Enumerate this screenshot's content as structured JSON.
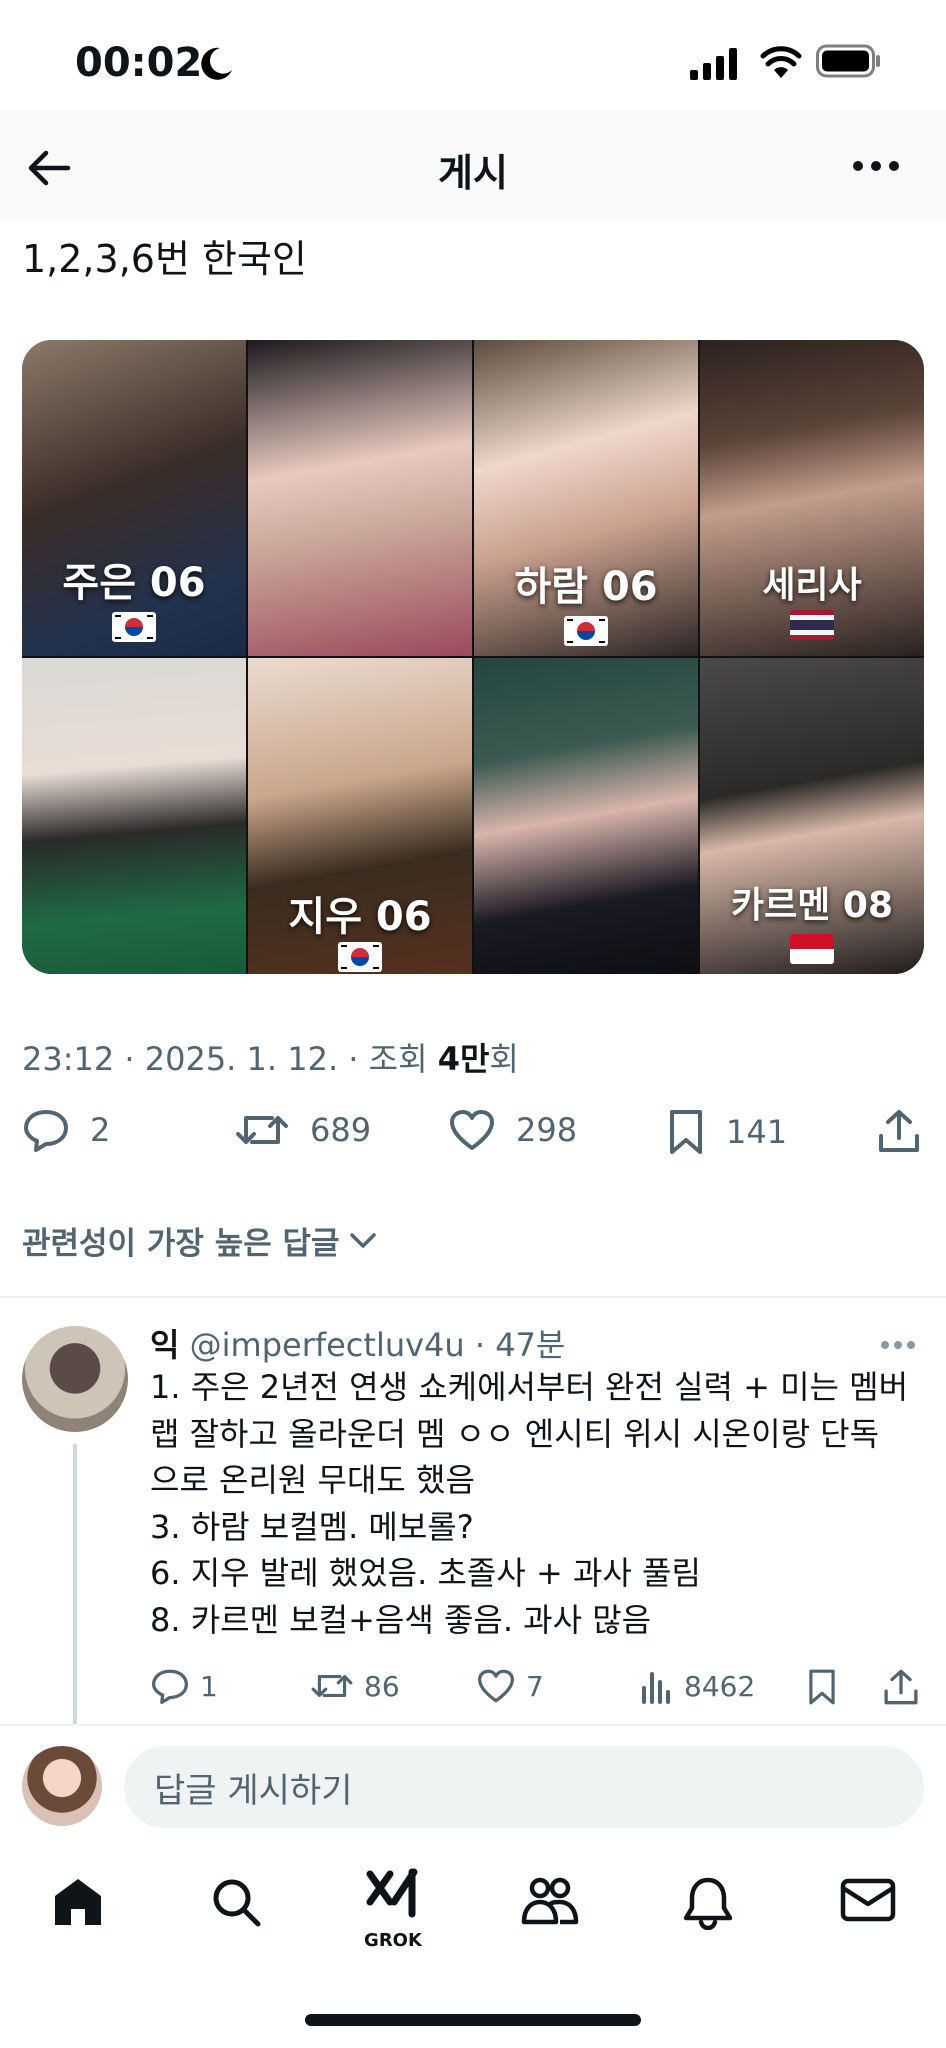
{
  "status_bar": {
    "time": "00:02"
  },
  "header": {
    "title": "게시"
  },
  "tweet": {
    "text": "1,2,3,6번 한국인",
    "images": [
      {
        "caption": "주은 06",
        "flag": "kr"
      },
      {
        "caption": "",
        "flag": ""
      },
      {
        "caption": "하람 06",
        "flag": "kr"
      },
      {
        "caption": "세리사",
        "flag": "th"
      },
      {
        "caption": "",
        "flag": ""
      },
      {
        "caption": "지우 06",
        "flag": "kr"
      },
      {
        "caption": "",
        "flag": ""
      },
      {
        "caption": "카르멘 08",
        "flag": "id"
      }
    ],
    "meta_prefix": "23:12 · 2025. 1. 12. · 조회 ",
    "views": "4만",
    "views_suffix": "회",
    "replies": "2",
    "reposts": "689",
    "likes": "298",
    "bookmarks": "141"
  },
  "sort_label": "관련성이 가장 높은 답글",
  "reply": {
    "name": "익",
    "handle": "@imperfectluv4u",
    "sep": " · ",
    "time": "47분",
    "lines": [
      "1. 주은 2년전 연생 쇼케에서부터 완전 실력 + 미는 멤버",
      "랩 잘하고 올라운더 멤 ㅇㅇ 엔시티 위시 시온이랑 단독",
      "으로 온리원 무대도 했음",
      "3. 하람 보컬멤. 메보롤?",
      "6. 지우 발레 했었음. 초졸사 + 과사 풀림",
      "8. 카르멘 보컬+음색 좋음. 과사 많음"
    ],
    "replies": "1",
    "reposts": "86",
    "likes": "7",
    "views": "8462"
  },
  "compose": {
    "placeholder": "답글 게시하기"
  },
  "tabbar": {
    "grok_label": "GROK"
  },
  "colors": {
    "text": "#0f1419",
    "secondary": "#536471",
    "divider": "#eff3f4"
  }
}
